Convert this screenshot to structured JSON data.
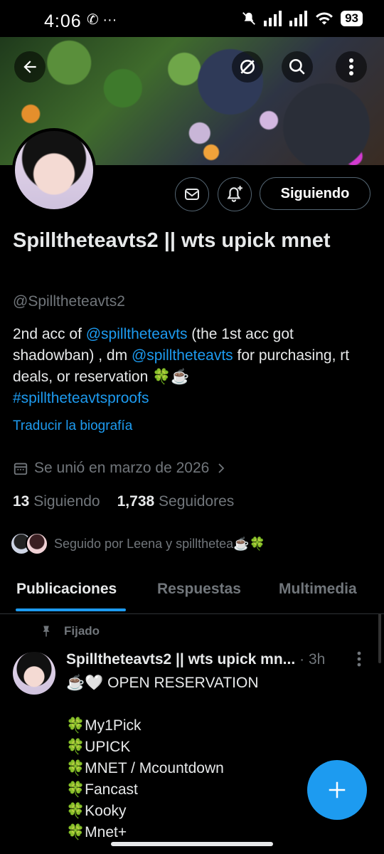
{
  "status_bar": {
    "time": "4:06",
    "left_icons": "✆ ···",
    "battery": "93"
  },
  "profile": {
    "name": "Spilltheteavts2 || wts upick mnet",
    "handle": "@Spilltheteavts2",
    "bio": {
      "text1": "2nd acc of ",
      "mention1": "@spilltheteavts",
      "text2": " (the 1st acc got shadowban) , dm ",
      "mention2": "@spilltheteavts",
      "text3": " for purchasing, rt deals, or reservation 🍀☕",
      "hashtag": "#spilltheteavtsproofs"
    },
    "translate_link": "Traducir la biografía",
    "joined": "Se unió en marzo de 2026",
    "following_count": "13",
    "following_label": "Siguiendo",
    "followers_count": "1,738",
    "followers_label": "Seguidores",
    "followed_by": "Seguido por Leena y spillthetea☕🍀",
    "follow_button": "Siguiendo"
  },
  "tabs": [
    {
      "label": "Publicaciones",
      "active": true
    },
    {
      "label": "Respuestas",
      "active": false
    },
    {
      "label": "Multimedia",
      "active": false
    }
  ],
  "pinned_post": {
    "pinned_label": "Fijado",
    "author": "Spilltheteavts2 || wts upick mn...",
    "time": "· 3h",
    "body": "☕🤍 OPEN RESERVATION\n\n🍀My1Pick\n🍀UPICK\n🍀MNET / Mcountdown\n🍀Fancast\n🍀Kooky\n🍀Mnet+"
  },
  "colors": {
    "accent": "#1d9bf0",
    "background": "#000000",
    "muted": "#71767b"
  }
}
